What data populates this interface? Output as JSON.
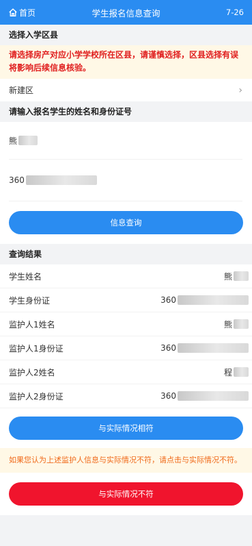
{
  "header": {
    "home_label": "首页",
    "title": "学生报名信息查询",
    "version": "7-26",
    "color": "#2a8cf1"
  },
  "district": {
    "section_title": "选择入学区县",
    "notice": "请选择房产对应小学学校所在区县，请谨慎选择，区县选择有误将影响后续信息核验。",
    "selected": "新建区"
  },
  "student_input": {
    "section_title": "请输入报名学生的姓名和身份证号",
    "name_value": "熊",
    "id_value": "360"
  },
  "query_button_label": "信息查询",
  "result": {
    "section_title": "查询结果",
    "rows": [
      {
        "label": "学生姓名",
        "value": "熊"
      },
      {
        "label": "学生身份证",
        "value": "360"
      },
      {
        "label": "监护人1姓名",
        "value": "熊"
      },
      {
        "label": "监护人1身份证",
        "value": "360"
      },
      {
        "label": "监护人2姓名",
        "value": "程"
      },
      {
        "label": "监护人2身份证",
        "value": "360"
      }
    ]
  },
  "match_button_label": "与实际情况相符",
  "tip": "如果您认为上述监护人信息与实际情况不符，请点击与实际情况不符。",
  "mismatch_button_label": "与实际情况不符",
  "colors": {
    "primary": "#2a8cf1",
    "danger": "#f0142d",
    "notice_text": "#e02020",
    "tip_text": "#f06a1a"
  }
}
